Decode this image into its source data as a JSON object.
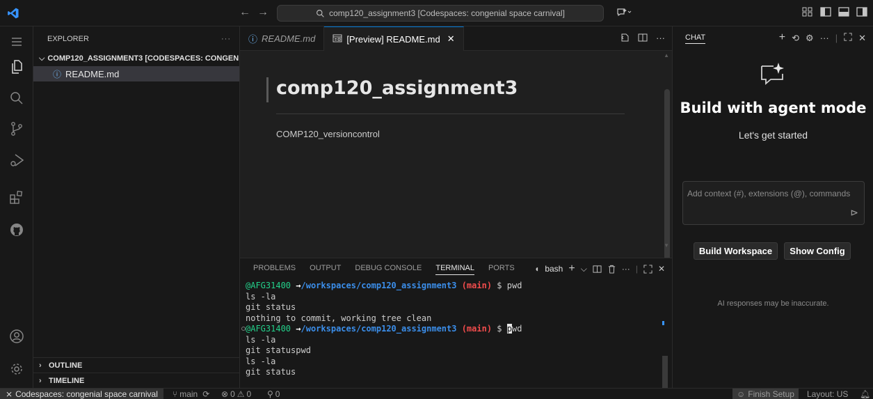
{
  "titlebar": {
    "search_text": "comp120_assignment3 [Codespaces: congenial space carnival]"
  },
  "sidebar": {
    "header": "EXPLORER",
    "more": "···",
    "root_folder": "COMP120_ASSIGNMENT3 [CODESPACES: CONGENI...",
    "files": [
      "README.md"
    ],
    "outline": "OUTLINE",
    "timeline": "TIMELINE"
  },
  "editor": {
    "tabs": [
      {
        "label": "README.md"
      },
      {
        "label": "[Preview] README.md"
      }
    ],
    "close_glyph": "✕",
    "preview": {
      "heading": "comp120_assignment3",
      "paragraph": "COMP120_versioncontrol"
    }
  },
  "panel": {
    "tabs": [
      "PROBLEMS",
      "OUTPUT",
      "DEBUG CONSOLE",
      "TERMINAL",
      "PORTS"
    ],
    "active_tab": "TERMINAL",
    "shell": "bash",
    "terminal": {
      "user": "@AFG31400",
      "arrow": "→",
      "path": "/workspaces/comp120_assignment3",
      "branch": "(main)",
      "prompt_suffix": " $ ",
      "cmd1": "pwd",
      "lines_after_1": [
        "ls -la",
        "git status",
        "nothing to commit, working tree clean"
      ],
      "cmd2_first": "p",
      "cmd2_rest": "wd",
      "lines_after_2": [
        "ls -la",
        "git statuspwd",
        "ls -la",
        "git status"
      ]
    }
  },
  "chat": {
    "title": "CHAT",
    "heading": "Build with agent mode",
    "subheading": "Let's get started",
    "input_placeholder": "Add context (#), extensions (@), commands",
    "buttons": [
      "Build Workspace",
      "Show Config"
    ],
    "note": "AI responses may be inaccurate."
  },
  "statusbar": {
    "remote": "Codespaces: congenial space carnival",
    "branch": "main",
    "errors": "0",
    "warnings": "0",
    "ports": "0",
    "finish_setup": "Finish Setup",
    "layout": "Layout: US"
  },
  "colors": {
    "accent": "#0078d4",
    "terminal_user": "#23d18b",
    "terminal_path": "#3b8eea",
    "terminal_branch": "#f14c4c"
  }
}
